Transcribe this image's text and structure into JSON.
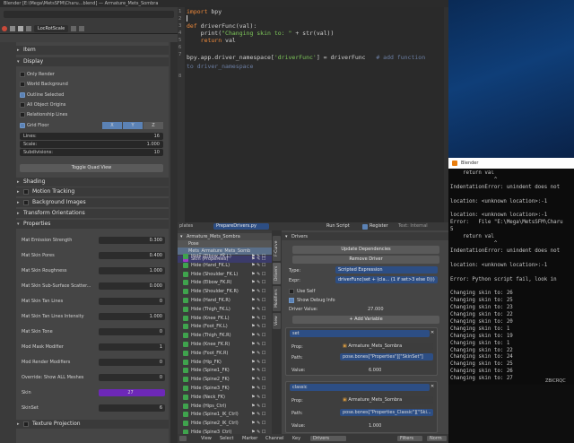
{
  "window": {
    "title": "Blender  [E:\\Mega\\MetsSFM\\Charu...blend] — Armature_Mets_Sombra"
  },
  "left_header": {
    "panel_title": "LocRotScale"
  },
  "properties": {
    "sections": {
      "item": "Item",
      "display": "Display",
      "shading": "Shading",
      "motion_tracking": "Motion Tracking",
      "background_images": "Background Images",
      "transform_orientations": "Transform Orientations",
      "properties": "Properties",
      "texture_projection": "Texture Projection"
    },
    "display_options": [
      {
        "label": "Only Render",
        "checked": false
      },
      {
        "label": "World Background",
        "checked": false
      },
      {
        "label": "Outline Selected",
        "checked": true
      },
      {
        "label": "All Object Origins",
        "checked": false
      },
      {
        "label": "Relationship Lines",
        "checked": false
      }
    ],
    "grid_floor": {
      "label": "Grid Floor",
      "axes": [
        "X",
        "Y",
        "Z"
      ]
    },
    "grid_fields": [
      {
        "label": "Lines:",
        "value": "16"
      },
      {
        "label": "Scale:",
        "value": "1.000"
      },
      {
        "label": "Subdivisions:",
        "value": "10"
      }
    ],
    "toggle_quad": "Toggle Quad View",
    "props": [
      {
        "label": "Mat Emission Strength",
        "value": "0.300"
      },
      {
        "label": "Mat Skin Pores",
        "value": "0.400"
      },
      {
        "label": "Mat Skin Roughness",
        "value": "1.000"
      },
      {
        "label": "Mat Skin Sub-Surface Scatter...",
        "value": "0.000"
      },
      {
        "label": "Mat Skin Tan Lines",
        "value": "0"
      },
      {
        "label": "Mat Skin Tan Lines Intensity",
        "value": "1.000"
      },
      {
        "label": "Mat Skin Tone",
        "value": "0"
      },
      {
        "label": "Mod Mask Modifier",
        "value": "1"
      },
      {
        "label": "Mod Render Modifiers",
        "value": "0"
      },
      {
        "label": "Override: Show ALL Meshes",
        "value": "0"
      },
      {
        "label": "Skin",
        "value": "27"
      },
      {
        "label": "SkinSet",
        "value": "6"
      }
    ]
  },
  "editor": {
    "lines": [
      "1",
      "2",
      "3",
      "4",
      "5",
      "6",
      "7",
      "8"
    ],
    "code": {
      "l1_kw": "import",
      "l1_rest": " bpy",
      "l3_kw": "def",
      "l3_rest": " driverFunc(val):",
      "l4_a": "    print(",
      "l4_str": "\"Changing skin to: \"",
      "l4_b": " + str(val))",
      "l5_kw": "    return",
      "l5_rest": " val",
      "l7_a": "bpy.app.driver_namespace[",
      "l7_str": "'driverFunc'",
      "l7_b": "] = driverFunc   ",
      "l7_cm": "# add function",
      "l8_cm": "to driver_namespace"
    },
    "footer": {
      "left": "plates",
      "file": "PrepareDrivers.py",
      "run": "Run Script",
      "register": "Register",
      "text_internal": "Text: Internal"
    }
  },
  "outliner": {
    "header": "Armature_Mets_Sombra",
    "subheader": "Pose",
    "bone_header": "Mets_Armature_Mets_Somb",
    "skin_prop": "Skin (Properties)",
    "bones": [
      "Hide (Elbow_FK.L)",
      "Hide (Hand_FK.L)",
      "Hide (Shoulder_FK.L)",
      "Hide (Elbow_FK.R)",
      "Hide (Shoulder_FK.R)",
      "Hide (Hand_FK.R)",
      "Hide (Thigh_FK.L)",
      "Hide (Knee_FK.L)",
      "Hide (Foot_FK.L)",
      "Hide (Thigh_FK.R)",
      "Hide (Knee_FK.R)",
      "Hide (Foot_FK.R)",
      "Hide (Hip_FK)",
      "Hide (Spine1_FK)",
      "Hide (Spine2_FK)",
      "Hide (Spine3_FK)",
      "Hide (Neck_FK)",
      "Hide (Hips_Ctrl)",
      "Hide (Spine1_IK_Ctrl)",
      "Hide (Spine2_IK_Ctrl)",
      "Hide (Spine3_Ctrl)"
    ]
  },
  "tabs": [
    "F-Curve",
    "Drivers",
    "Modifiers",
    "View"
  ],
  "drivers": {
    "title": "Drivers",
    "update_deps": "Update Dependencies",
    "remove_driver": "Remove Driver",
    "type_label": "Type:",
    "type_value": "Scripted Expression",
    "expr_label": "Expr:",
    "expr_value": "driverFunc(set + (cla... (1 if set>3 else 0)))",
    "use_self": "Use Self",
    "show_debug": "Show Debug Info",
    "driver_value_label": "Driver Value:",
    "driver_value": "27.000",
    "add_variable": "Add Variable",
    "vars": [
      {
        "name": "set",
        "prop_label": "Prop:",
        "prop": "Armature_Mets_Sombra",
        "path_label": "Path:",
        "path": "pose.bones[\"Properties\"][\"SkinSet\"]",
        "value_label": "Value:",
        "value": "6.000"
      },
      {
        "name": "classic",
        "prop_label": "Prop:",
        "prop": "Armature_Mets_Sombra",
        "path_label": "Path:",
        "path": "pose.bones[\"Properties_Classic\"][\"Ski...",
        "value_label": "Value:",
        "value": "1.000"
      }
    ]
  },
  "bottom": {
    "view": "View",
    "select": "Select",
    "marker": "Marker",
    "channel": "Channel",
    "key": "Key",
    "mode": "Drivers",
    "filters": "Filters",
    "norm": "Norm"
  },
  "console": {
    "title": "Blender",
    "lines": [
      "    return val",
      "              ^",
      "IndentationError: unindent does not",
      "",
      "location: <unknown location>:-1",
      "",
      "location: <unknown location>:-1",
      "Error:   File \"E:\\Mega\\MetsSFM\\Charu",
      "5",
      "    return val",
      "              ^",
      "IndentationError: unindent does not",
      "",
      "location: <unknown location>:-1",
      "",
      "Error: Python script fail, look in",
      "",
      "Changing skin to: 26",
      "Changing skin to: 25",
      "Changing skin to: 23",
      "Changing skin to: 22",
      "Changing skin to: 20",
      "Changing skin to: 1",
      "Changing skin to: 19",
      "Changing skin to: 1",
      "Changing skin to: 22",
      "Changing skin to: 24",
      "Changing skin to: 25",
      "Changing skin to: 26",
      "Changing skin to: 27"
    ],
    "tray": "ZBICRQC"
  },
  "colors": {
    "accent": "#5b82b5",
    "skin_bar": "#6d28b8",
    "keyword": "#f08a3b",
    "string": "#7ec85a"
  }
}
